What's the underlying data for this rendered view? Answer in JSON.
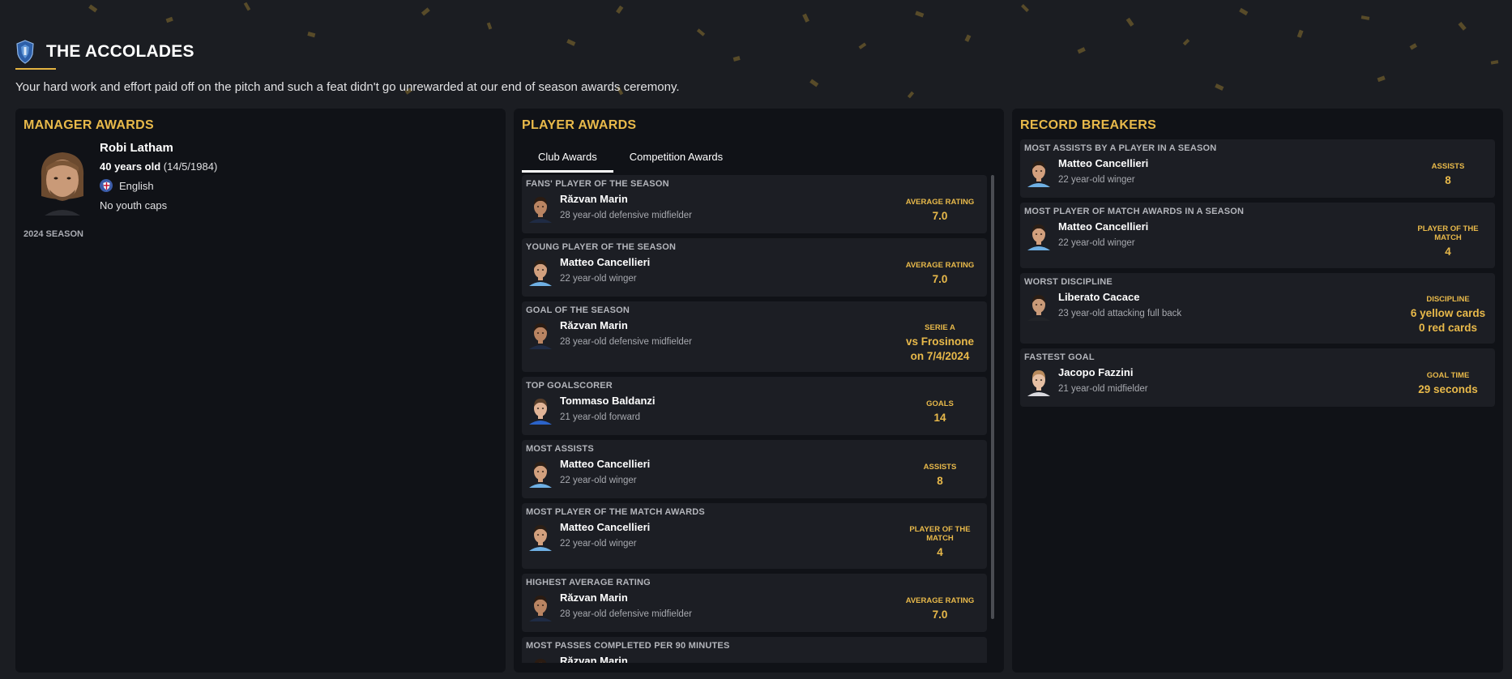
{
  "header": {
    "title": "THE ACCOLADES",
    "intro": "Your hard work and effort paid off on the pitch and such a feat didn't go unrewarded at our end of season awards ceremony."
  },
  "colors": {
    "accent": "#e8b94a",
    "panel": "#101217",
    "card": "#1c1e24",
    "background": "#1b1d22"
  },
  "manager": {
    "title": "MANAGER AWARDS",
    "name": "Robi Latham",
    "age": "40 years old",
    "dob": "(14/5/1984)",
    "nationality": "English",
    "caps": "No youth caps",
    "season": "2024 SEASON"
  },
  "player_awards": {
    "title": "PLAYER AWARDS",
    "tabs": [
      "Club Awards",
      "Competition Awards"
    ],
    "active_tab": "Club Awards",
    "items": [
      {
        "title": "FANS' PLAYER OF THE SEASON",
        "name": "Răzvan Marin",
        "desc": "28 year-old defensive midfielder",
        "stat_label": "AVERAGE RATING",
        "stat_value": "7.0"
      },
      {
        "title": "YOUNG PLAYER OF THE SEASON",
        "name": "Matteo Cancellieri",
        "desc": "22 year-old winger",
        "stat_label": "AVERAGE RATING",
        "stat_value": "7.0"
      },
      {
        "title": "GOAL OF THE SEASON",
        "name": "Răzvan Marin",
        "desc": "28 year-old defensive midfielder",
        "stat_label": "SERIE A",
        "stat_value": "vs Frosinone on 7/4/2024"
      },
      {
        "title": "TOP GOALSCORER",
        "name": "Tommaso Baldanzi",
        "desc": "21 year-old forward",
        "stat_label": "GOALS",
        "stat_value": "14"
      },
      {
        "title": "MOST ASSISTS",
        "name": "Matteo Cancellieri",
        "desc": "22 year-old winger",
        "stat_label": "ASSISTS",
        "stat_value": "8"
      },
      {
        "title": "MOST PLAYER OF THE MATCH AWARDS",
        "name": "Matteo Cancellieri",
        "desc": "22 year-old winger",
        "stat_label": "PLAYER OF THE MATCH",
        "stat_value": "4"
      },
      {
        "title": "HIGHEST AVERAGE RATING",
        "name": "Răzvan Marin",
        "desc": "28 year-old defensive midfielder",
        "stat_label": "AVERAGE RATING",
        "stat_value": "7.0"
      },
      {
        "title": "MOST PASSES COMPLETED PER 90 MINUTES",
        "name": "Răzvan Marin",
        "desc": "",
        "stat_label": "",
        "stat_value": ""
      }
    ]
  },
  "record_breakers": {
    "title": "RECORD BREAKERS",
    "items": [
      {
        "title": "MOST ASSISTS BY A PLAYER IN A SEASON",
        "name": "Matteo Cancellieri",
        "desc": "22 year-old winger",
        "stat_label": "ASSISTS",
        "stat_value": "8"
      },
      {
        "title": "MOST PLAYER OF MATCH AWARDS IN A SEASON",
        "name": "Matteo Cancellieri",
        "desc": "22 year-old winger",
        "stat_label": "PLAYER OF THE MATCH",
        "stat_value": "4"
      },
      {
        "title": "WORST DISCIPLINE",
        "name": "Liberato Cacace",
        "desc": "23 year-old attacking full back",
        "stat_label": "DISCIPLINE",
        "stat_value": "6 yellow cards 0 red cards"
      },
      {
        "title": "FASTEST GOAL",
        "name": "Jacopo Fazzini",
        "desc": "21 year-old midfielder",
        "stat_label": "GOAL TIME",
        "stat_value": "29 seconds"
      }
    ]
  }
}
